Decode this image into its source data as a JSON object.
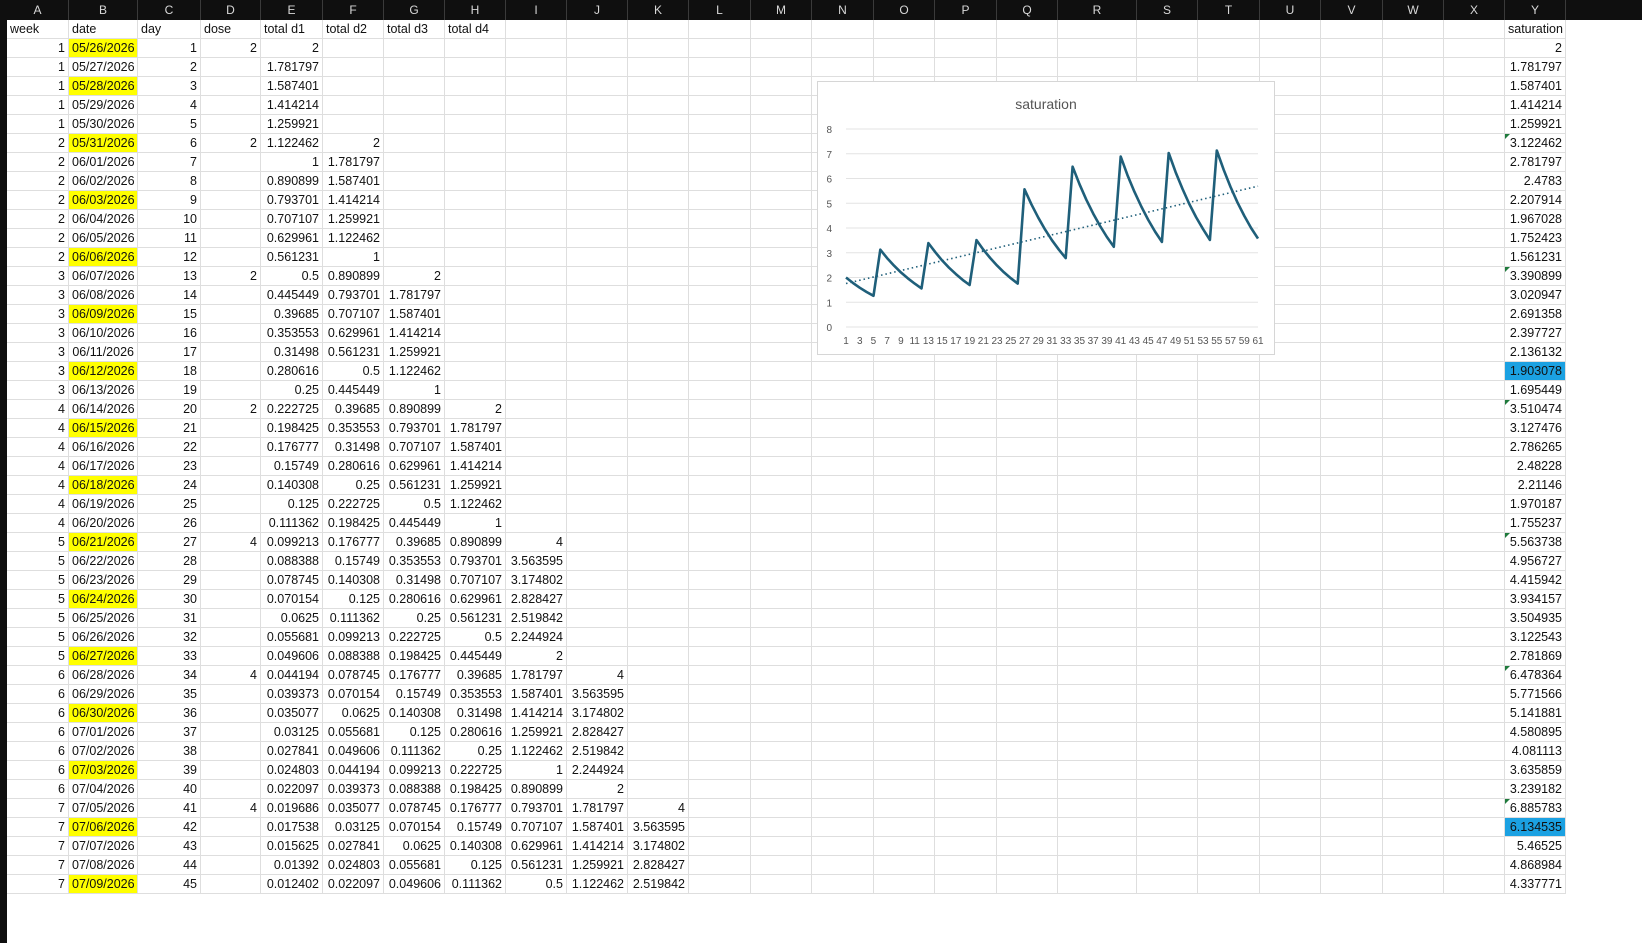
{
  "columns": [
    "A",
    "B",
    "C",
    "D",
    "E",
    "F",
    "G",
    "H",
    "I",
    "J",
    "K",
    "L",
    "M",
    "N",
    "O",
    "P",
    "Q",
    "R",
    "S",
    "T",
    "U",
    "V",
    "W",
    "X",
    "Y"
  ],
  "headers": {
    "week": "week",
    "date": "date",
    "day": "day",
    "dose": "dose",
    "d1": "total d1",
    "d2": "total d2",
    "d3": "total d3",
    "d4": "total d4",
    "sat": "saturation"
  },
  "colors": {
    "highlight": "#ffff00",
    "selected": "#1ba1e2",
    "line": "#1f5f7a",
    "trend": "#1f5f7a"
  },
  "rows": [
    [
      "1",
      "05/26/2026",
      "1",
      "2",
      "2",
      "",
      "",
      "",
      "",
      "",
      "",
      "2",
      1,
      0,
      0
    ],
    [
      "1",
      "05/27/2026",
      "2",
      "",
      "1.781797",
      "",
      "",
      "",
      "",
      "",
      "",
      "1.781797",
      0,
      0,
      0
    ],
    [
      "1",
      "05/28/2026",
      "3",
      "",
      "1.587401",
      "",
      "",
      "",
      "",
      "",
      "",
      "1.587401",
      1,
      0,
      0
    ],
    [
      "1",
      "05/29/2026",
      "4",
      "",
      "1.414214",
      "",
      "",
      "",
      "",
      "",
      "",
      "1.414214",
      0,
      0,
      0
    ],
    [
      "1",
      "05/30/2026",
      "5",
      "",
      "1.259921",
      "",
      "",
      "",
      "",
      "",
      "",
      "1.259921",
      0,
      0,
      0
    ],
    [
      "2",
      "05/31/2026",
      "6",
      "2",
      "1.122462",
      "2",
      "",
      "",
      "",
      "",
      "",
      "3.122462",
      1,
      0,
      1
    ],
    [
      "2",
      "06/01/2026",
      "7",
      "",
      "1",
      "1.781797",
      "",
      "",
      "",
      "",
      "",
      "2.781797",
      0,
      0,
      0
    ],
    [
      "2",
      "06/02/2026",
      "8",
      "",
      "0.890899",
      "1.587401",
      "",
      "",
      "",
      "",
      "",
      "2.4783",
      0,
      0,
      0
    ],
    [
      "2",
      "06/03/2026",
      "9",
      "",
      "0.793701",
      "1.414214",
      "",
      "",
      "",
      "",
      "",
      "2.207914",
      1,
      0,
      0
    ],
    [
      "2",
      "06/04/2026",
      "10",
      "",
      "0.707107",
      "1.259921",
      "",
      "",
      "",
      "",
      "",
      "1.967028",
      0,
      0,
      0
    ],
    [
      "2",
      "06/05/2026",
      "11",
      "",
      "0.629961",
      "1.122462",
      "",
      "",
      "",
      "",
      "",
      "1.752423",
      0,
      0,
      0
    ],
    [
      "2",
      "06/06/2026",
      "12",
      "",
      "0.561231",
      "1",
      "",
      "",
      "",
      "",
      "",
      "1.561231",
      1,
      0,
      0
    ],
    [
      "3",
      "06/07/2026",
      "13",
      "2",
      "0.5",
      "0.890899",
      "2",
      "",
      "",
      "",
      "",
      "3.390899",
      0,
      0,
      1
    ],
    [
      "3",
      "06/08/2026",
      "14",
      "",
      "0.445449",
      "0.793701",
      "1.781797",
      "",
      "",
      "",
      "",
      "3.020947",
      0,
      0,
      0
    ],
    [
      "3",
      "06/09/2026",
      "15",
      "",
      "0.39685",
      "0.707107",
      "1.587401",
      "",
      "",
      "",
      "",
      "2.691358",
      1,
      0,
      0
    ],
    [
      "3",
      "06/10/2026",
      "16",
      "",
      "0.353553",
      "0.629961",
      "1.414214",
      "",
      "",
      "",
      "",
      "2.397727",
      0,
      0,
      0
    ],
    [
      "3",
      "06/11/2026",
      "17",
      "",
      "0.31498",
      "0.561231",
      "1.259921",
      "",
      "",
      "",
      "",
      "2.136132",
      0,
      0,
      0
    ],
    [
      "3",
      "06/12/2026",
      "18",
      "",
      "0.280616",
      "0.5",
      "1.122462",
      "",
      "",
      "",
      "",
      "1.903078",
      1,
      1,
      0
    ],
    [
      "3",
      "06/13/2026",
      "19",
      "",
      "0.25",
      "0.445449",
      "1",
      "",
      "",
      "",
      "",
      "1.695449",
      0,
      0,
      0
    ],
    [
      "4",
      "06/14/2026",
      "20",
      "2",
      "0.222725",
      "0.39685",
      "0.890899",
      "2",
      "",
      "",
      "",
      "3.510474",
      0,
      0,
      1
    ],
    [
      "4",
      "06/15/2026",
      "21",
      "",
      "0.198425",
      "0.353553",
      "0.793701",
      "1.781797",
      "",
      "",
      "",
      "3.127476",
      1,
      0,
      0
    ],
    [
      "4",
      "06/16/2026",
      "22",
      "",
      "0.176777",
      "0.31498",
      "0.707107",
      "1.587401",
      "",
      "",
      "",
      "2.786265",
      0,
      0,
      0
    ],
    [
      "4",
      "06/17/2026",
      "23",
      "",
      "0.15749",
      "0.280616",
      "0.629961",
      "1.414214",
      "",
      "",
      "",
      "2.48228",
      0,
      0,
      0
    ],
    [
      "4",
      "06/18/2026",
      "24",
      "",
      "0.140308",
      "0.25",
      "0.561231",
      "1.259921",
      "",
      "",
      "",
      "2.21146",
      1,
      0,
      0
    ],
    [
      "4",
      "06/19/2026",
      "25",
      "",
      "0.125",
      "0.222725",
      "0.5",
      "1.122462",
      "",
      "",
      "",
      "1.970187",
      0,
      0,
      0
    ],
    [
      "4",
      "06/20/2026",
      "26",
      "",
      "0.111362",
      "0.198425",
      "0.445449",
      "1",
      "",
      "",
      "",
      "1.755237",
      0,
      0,
      0
    ],
    [
      "5",
      "06/21/2026",
      "27",
      "4",
      "0.099213",
      "0.176777",
      "0.39685",
      "0.890899",
      "4",
      "",
      "",
      "5.563738",
      1,
      0,
      1
    ],
    [
      "5",
      "06/22/2026",
      "28",
      "",
      "0.088388",
      "0.15749",
      "0.353553",
      "0.793701",
      "3.563595",
      "",
      "",
      "4.956727",
      0,
      0,
      0
    ],
    [
      "5",
      "06/23/2026",
      "29",
      "",
      "0.078745",
      "0.140308",
      "0.31498",
      "0.707107",
      "3.174802",
      "",
      "",
      "4.415942",
      0,
      0,
      0
    ],
    [
      "5",
      "06/24/2026",
      "30",
      "",
      "0.070154",
      "0.125",
      "0.280616",
      "0.629961",
      "2.828427",
      "",
      "",
      "3.934157",
      1,
      0,
      0
    ],
    [
      "5",
      "06/25/2026",
      "31",
      "",
      "0.0625",
      "0.111362",
      "0.25",
      "0.561231",
      "2.519842",
      "",
      "",
      "3.504935",
      0,
      0,
      0
    ],
    [
      "5",
      "06/26/2026",
      "32",
      "",
      "0.055681",
      "0.099213",
      "0.222725",
      "0.5",
      "2.244924",
      "",
      "",
      "3.122543",
      0,
      0,
      0
    ],
    [
      "5",
      "06/27/2026",
      "33",
      "",
      "0.049606",
      "0.088388",
      "0.198425",
      "0.445449",
      "2",
      "",
      "",
      "2.781869",
      1,
      0,
      0
    ],
    [
      "6",
      "06/28/2026",
      "34",
      "4",
      "0.044194",
      "0.078745",
      "0.176777",
      "0.39685",
      "1.781797",
      "4",
      "",
      "6.478364",
      0,
      0,
      1
    ],
    [
      "6",
      "06/29/2026",
      "35",
      "",
      "0.039373",
      "0.070154",
      "0.15749",
      "0.353553",
      "1.587401",
      "3.563595",
      "",
      "5.771566",
      0,
      0,
      0
    ],
    [
      "6",
      "06/30/2026",
      "36",
      "",
      "0.035077",
      "0.0625",
      "0.140308",
      "0.31498",
      "1.414214",
      "3.174802",
      "",
      "5.141881",
      1,
      0,
      0
    ],
    [
      "6",
      "07/01/2026",
      "37",
      "",
      "0.03125",
      "0.055681",
      "0.125",
      "0.280616",
      "1.259921",
      "2.828427",
      "",
      "4.580895",
      0,
      0,
      0
    ],
    [
      "6",
      "07/02/2026",
      "38",
      "",
      "0.027841",
      "0.049606",
      "0.111362",
      "0.25",
      "1.122462",
      "2.519842",
      "",
      "4.081113",
      0,
      0,
      0
    ],
    [
      "6",
      "07/03/2026",
      "39",
      "",
      "0.024803",
      "0.044194",
      "0.099213",
      "0.222725",
      "1",
      "2.244924",
      "",
      "3.635859",
      1,
      0,
      0
    ],
    [
      "6",
      "07/04/2026",
      "40",
      "",
      "0.022097",
      "0.039373",
      "0.088388",
      "0.198425",
      "0.890899",
      "2",
      "",
      "3.239182",
      0,
      0,
      0
    ],
    [
      "7",
      "07/05/2026",
      "41",
      "4",
      "0.019686",
      "0.035077",
      "0.078745",
      "0.176777",
      "0.793701",
      "1.781797",
      "4",
      "6.885783",
      0,
      0,
      1
    ],
    [
      "7",
      "07/06/2026",
      "42",
      "",
      "0.017538",
      "0.03125",
      "0.070154",
      "0.15749",
      "0.707107",
      "1.587401",
      "3.563595",
      "6.134535",
      1,
      1,
      0
    ],
    [
      "7",
      "07/07/2026",
      "43",
      "",
      "0.015625",
      "0.027841",
      "0.0625",
      "0.140308",
      "0.629961",
      "1.414214",
      "3.174802",
      "5.46525",
      0,
      0,
      0
    ],
    [
      "7",
      "07/08/2026",
      "44",
      "",
      "0.01392",
      "0.024803",
      "0.055681",
      "0.125",
      "0.561231",
      "1.259921",
      "2.828427",
      "4.868984",
      0,
      0,
      0
    ],
    [
      "7",
      "07/09/2026",
      "45",
      "",
      "0.012402",
      "0.022097",
      "0.049606",
      "0.111362",
      "0.5",
      "1.122462",
      "2.519842",
      "4.337771",
      1,
      0,
      0
    ]
  ],
  "chart_data": {
    "type": "line",
    "title": "saturation",
    "x": [
      1,
      2,
      3,
      4,
      5,
      6,
      7,
      8,
      9,
      10,
      11,
      12,
      13,
      14,
      15,
      16,
      17,
      18,
      19,
      20,
      21,
      22,
      23,
      24,
      25,
      26,
      27,
      28,
      29,
      30,
      31,
      32,
      33,
      34,
      35,
      36,
      37,
      38,
      39,
      40,
      41,
      42,
      43,
      44,
      45,
      46,
      47,
      48,
      49,
      50,
      51,
      52,
      53,
      54,
      55,
      56,
      57,
      58,
      59,
      60,
      61
    ],
    "xticks": [
      "1",
      "3",
      "5",
      "7",
      "9",
      "11",
      "13",
      "15",
      "17",
      "19",
      "21",
      "23",
      "25",
      "27",
      "29",
      "31",
      "33",
      "35",
      "37",
      "39",
      "41",
      "43",
      "45",
      "47",
      "49",
      "51",
      "53",
      "55",
      "57",
      "59",
      "61"
    ],
    "ylim": [
      0,
      8
    ],
    "yticks": [
      "0",
      "1",
      "2",
      "3",
      "4",
      "5",
      "6",
      "7",
      "8"
    ],
    "series": [
      {
        "values": [
          2,
          1.781797,
          1.587401,
          1.414214,
          1.259921,
          3.122462,
          2.781797,
          2.4783,
          2.207914,
          1.967028,
          1.752423,
          1.561231,
          3.390899,
          3.020947,
          2.691358,
          2.397727,
          2.136132,
          1.903078,
          1.695449,
          3.510474,
          3.127476,
          2.786265,
          2.48228,
          2.21146,
          1.970187,
          1.755237,
          5.563738,
          4.956727,
          4.415942,
          3.934157,
          3.504935,
          3.122543,
          2.781869,
          6.478364,
          5.771566,
          5.141881,
          4.580895,
          4.081113,
          3.635859,
          3.239182,
          6.885783,
          6.134535,
          5.46525,
          4.868984,
          4.337771,
          3.86,
          3.44,
          7.03,
          6.26,
          5.58,
          4.97,
          4.43,
          3.95,
          3.52,
          7.13,
          6.35,
          5.66,
          5.04,
          4.49,
          4.0,
          3.57
        ]
      }
    ],
    "trendline": {
      "type": "linear",
      "style": "dotted"
    },
    "grid": true,
    "legend": "none"
  }
}
